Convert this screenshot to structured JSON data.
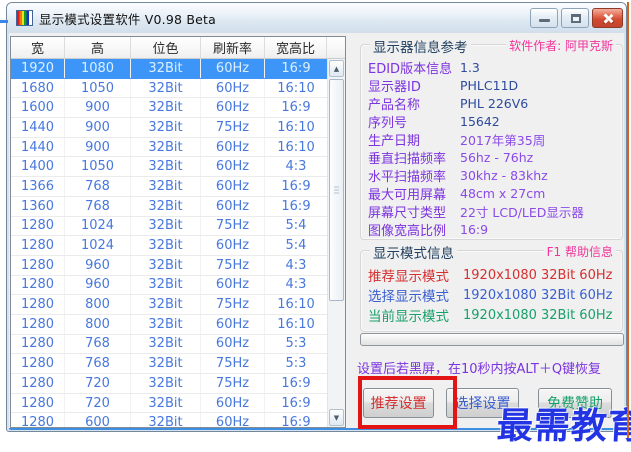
{
  "window": {
    "title": "显示模式设置软件 V0.98 Beta"
  },
  "table": {
    "columns": [
      "宽",
      "高",
      "位色",
      "刷新率",
      "宽高比"
    ],
    "selected_index": 0,
    "rows": [
      [
        "1920",
        "1080",
        "32Bit",
        "60Hz",
        "16:9"
      ],
      [
        "1680",
        "1050",
        "32Bit",
        "60Hz",
        "16:10"
      ],
      [
        "1600",
        "900",
        "32Bit",
        "60Hz",
        "16:9"
      ],
      [
        "1440",
        "900",
        "32Bit",
        "75Hz",
        "16:10"
      ],
      [
        "1440",
        "900",
        "32Bit",
        "60Hz",
        "16:10"
      ],
      [
        "1400",
        "1050",
        "32Bit",
        "60Hz",
        "4:3"
      ],
      [
        "1366",
        "768",
        "32Bit",
        "60Hz",
        "16:9"
      ],
      [
        "1360",
        "768",
        "32Bit",
        "60Hz",
        "16:9"
      ],
      [
        "1280",
        "1024",
        "32Bit",
        "75Hz",
        "5:4"
      ],
      [
        "1280",
        "1024",
        "32Bit",
        "60Hz",
        "5:4"
      ],
      [
        "1280",
        "960",
        "32Bit",
        "75Hz",
        "4:3"
      ],
      [
        "1280",
        "960",
        "32Bit",
        "60Hz",
        "4:3"
      ],
      [
        "1280",
        "800",
        "32Bit",
        "75Hz",
        "16:10"
      ],
      [
        "1280",
        "800",
        "32Bit",
        "60Hz",
        "16:10"
      ],
      [
        "1280",
        "768",
        "32Bit",
        "60Hz",
        "5:3"
      ],
      [
        "1280",
        "768",
        "32Bit",
        "75Hz",
        "5:3"
      ],
      [
        "1280",
        "720",
        "32Bit",
        "75Hz",
        "16:9"
      ],
      [
        "1280",
        "720",
        "32Bit",
        "60Hz",
        "16:9"
      ],
      [
        "1280",
        "600",
        "32Bit",
        "60Hz",
        "16:9"
      ]
    ]
  },
  "info_panel": {
    "title": "显示器信息参考",
    "author_note": "软件作者: 阿甲克斯",
    "items": [
      {
        "label": "EDID版本信息",
        "value": "1.3",
        "value_color": "navy"
      },
      {
        "label": "显示器ID",
        "value": "PHLC11D",
        "value_color": "navy"
      },
      {
        "label": "产品名称",
        "value": "PHL 226V6",
        "value_color": "navy"
      },
      {
        "label": "序列号",
        "value": "15642",
        "value_color": "navy"
      },
      {
        "label": "生产日期",
        "value": "2017年第35周",
        "value_color": "purple"
      },
      {
        "label": "垂直扫描频率",
        "value": "56hz  -  76hz",
        "value_color": "purple"
      },
      {
        "label": "水平扫描频率",
        "value": "30khz - 83khz",
        "value_color": "purple"
      },
      {
        "label": "最大可用屏幕",
        "value": "48cm x 27cm",
        "value_color": "purple"
      },
      {
        "label": "屏幕尺寸类型",
        "value": "22寸 LCD/LED显示器",
        "value_color": "purple"
      },
      {
        "label": "图像宽高比例",
        "value": "16:9",
        "value_color": "purple"
      }
    ]
  },
  "mode_panel": {
    "title": "显示模式信息",
    "help_note": "F1 帮助信息",
    "items": [
      {
        "label": "推荐显示模式",
        "value": "1920x1080 32Bit 60Hz",
        "color_key": "red"
      },
      {
        "label": "选择显示模式",
        "value": "1920x1080 32Bit 60Hz",
        "color_key": "blue"
      },
      {
        "label": "当前显示模式",
        "value": "1920x1080 32Bit 60Hz",
        "color_key": "green"
      }
    ]
  },
  "hint": "设置后若黑屏，在10秒内按ALT＋Q键恢复",
  "buttons": [
    {
      "label": "推荐设置",
      "color_key": "red",
      "highlighted": true
    },
    {
      "label": "选择设置",
      "color_key": "blue",
      "highlighted": false
    },
    {
      "label": "免费赞助",
      "color_key": "green",
      "highlighted": false
    }
  ],
  "watermark": "最需教育",
  "colors": {
    "red": "#d43030",
    "blue": "#3a5fd0",
    "green": "#18a06a",
    "navy": "#2e4a9e",
    "purple": "#8a4ae8",
    "label_purple": "#7c33e0",
    "pink": "#f0369a",
    "selection_bg": "#3d96f7",
    "selection_text": "#ddefff",
    "table_text": "#4878dd",
    "annotation_red": "#e21414",
    "watermark_blue": "#2334e4"
  }
}
